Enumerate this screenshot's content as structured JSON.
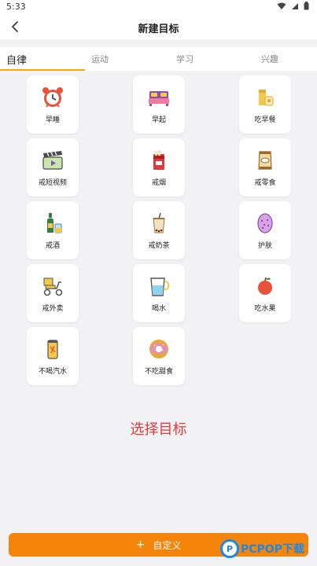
{
  "status": {
    "time": "5:33"
  },
  "header": {
    "title": "新建目标"
  },
  "tabs": [
    {
      "label": "自律",
      "active": true
    },
    {
      "label": "运动",
      "active": false
    },
    {
      "label": "学习",
      "active": false
    },
    {
      "label": "兴趣",
      "active": false
    }
  ],
  "goals": [
    {
      "label": "早睡",
      "icon": "alarm-clock-icon"
    },
    {
      "label": "早起",
      "icon": "bed-icon"
    },
    {
      "label": "吃早餐",
      "icon": "breakfast-icon"
    },
    {
      "label": "戒短视频",
      "icon": "video-icon"
    },
    {
      "label": "戒烟",
      "icon": "cigarette-icon"
    },
    {
      "label": "戒零食",
      "icon": "snack-bag-icon"
    },
    {
      "label": "戒酒",
      "icon": "liquor-icon"
    },
    {
      "label": "戒奶茶",
      "icon": "milk-tea-icon"
    },
    {
      "label": "护肤",
      "icon": "skincare-icon"
    },
    {
      "label": "戒外卖",
      "icon": "delivery-scooter-icon"
    },
    {
      "label": "喝水",
      "icon": "water-glass-icon"
    },
    {
      "label": "吃水果",
      "icon": "apple-icon"
    },
    {
      "label": "不喝汽水",
      "icon": "soda-can-icon"
    },
    {
      "label": "不吃甜食",
      "icon": "donut-icon"
    }
  ],
  "prompt": "选择目标",
  "custom_button": {
    "label": "自定义"
  },
  "watermark": {
    "text": "PCPOP下载"
  },
  "colors": {
    "accent": "#f5840a",
    "prompt": "#e03a3a",
    "tab_underline": "#f5a623"
  }
}
